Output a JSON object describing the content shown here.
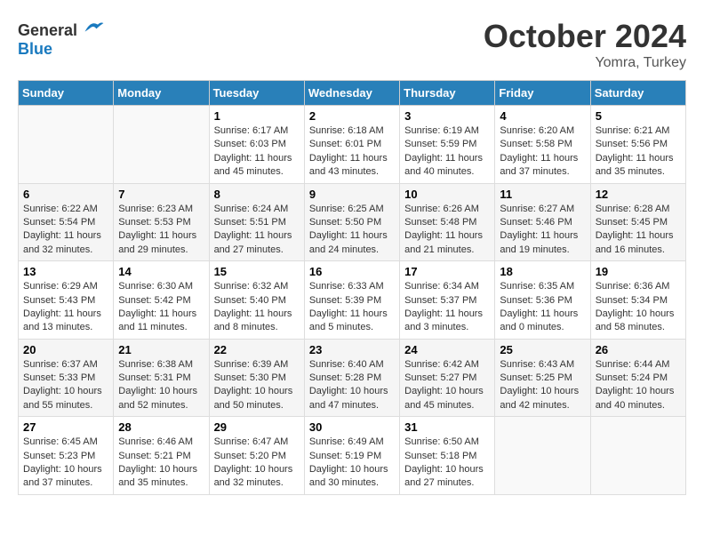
{
  "header": {
    "logo_general": "General",
    "logo_blue": "Blue",
    "month": "October 2024",
    "location": "Yomra, Turkey"
  },
  "weekdays": [
    "Sunday",
    "Monday",
    "Tuesday",
    "Wednesday",
    "Thursday",
    "Friday",
    "Saturday"
  ],
  "weeks": [
    [
      {
        "day": "",
        "info": ""
      },
      {
        "day": "",
        "info": ""
      },
      {
        "day": "1",
        "info": "Sunrise: 6:17 AM\nSunset: 6:03 PM\nDaylight: 11 hours and 45 minutes."
      },
      {
        "day": "2",
        "info": "Sunrise: 6:18 AM\nSunset: 6:01 PM\nDaylight: 11 hours and 43 minutes."
      },
      {
        "day": "3",
        "info": "Sunrise: 6:19 AM\nSunset: 5:59 PM\nDaylight: 11 hours and 40 minutes."
      },
      {
        "day": "4",
        "info": "Sunrise: 6:20 AM\nSunset: 5:58 PM\nDaylight: 11 hours and 37 minutes."
      },
      {
        "day": "5",
        "info": "Sunrise: 6:21 AM\nSunset: 5:56 PM\nDaylight: 11 hours and 35 minutes."
      }
    ],
    [
      {
        "day": "6",
        "info": "Sunrise: 6:22 AM\nSunset: 5:54 PM\nDaylight: 11 hours and 32 minutes."
      },
      {
        "day": "7",
        "info": "Sunrise: 6:23 AM\nSunset: 5:53 PM\nDaylight: 11 hours and 29 minutes."
      },
      {
        "day": "8",
        "info": "Sunrise: 6:24 AM\nSunset: 5:51 PM\nDaylight: 11 hours and 27 minutes."
      },
      {
        "day": "9",
        "info": "Sunrise: 6:25 AM\nSunset: 5:50 PM\nDaylight: 11 hours and 24 minutes."
      },
      {
        "day": "10",
        "info": "Sunrise: 6:26 AM\nSunset: 5:48 PM\nDaylight: 11 hours and 21 minutes."
      },
      {
        "day": "11",
        "info": "Sunrise: 6:27 AM\nSunset: 5:46 PM\nDaylight: 11 hours and 19 minutes."
      },
      {
        "day": "12",
        "info": "Sunrise: 6:28 AM\nSunset: 5:45 PM\nDaylight: 11 hours and 16 minutes."
      }
    ],
    [
      {
        "day": "13",
        "info": "Sunrise: 6:29 AM\nSunset: 5:43 PM\nDaylight: 11 hours and 13 minutes."
      },
      {
        "day": "14",
        "info": "Sunrise: 6:30 AM\nSunset: 5:42 PM\nDaylight: 11 hours and 11 minutes."
      },
      {
        "day": "15",
        "info": "Sunrise: 6:32 AM\nSunset: 5:40 PM\nDaylight: 11 hours and 8 minutes."
      },
      {
        "day": "16",
        "info": "Sunrise: 6:33 AM\nSunset: 5:39 PM\nDaylight: 11 hours and 5 minutes."
      },
      {
        "day": "17",
        "info": "Sunrise: 6:34 AM\nSunset: 5:37 PM\nDaylight: 11 hours and 3 minutes."
      },
      {
        "day": "18",
        "info": "Sunrise: 6:35 AM\nSunset: 5:36 PM\nDaylight: 11 hours and 0 minutes."
      },
      {
        "day": "19",
        "info": "Sunrise: 6:36 AM\nSunset: 5:34 PM\nDaylight: 10 hours and 58 minutes."
      }
    ],
    [
      {
        "day": "20",
        "info": "Sunrise: 6:37 AM\nSunset: 5:33 PM\nDaylight: 10 hours and 55 minutes."
      },
      {
        "day": "21",
        "info": "Sunrise: 6:38 AM\nSunset: 5:31 PM\nDaylight: 10 hours and 52 minutes."
      },
      {
        "day": "22",
        "info": "Sunrise: 6:39 AM\nSunset: 5:30 PM\nDaylight: 10 hours and 50 minutes."
      },
      {
        "day": "23",
        "info": "Sunrise: 6:40 AM\nSunset: 5:28 PM\nDaylight: 10 hours and 47 minutes."
      },
      {
        "day": "24",
        "info": "Sunrise: 6:42 AM\nSunset: 5:27 PM\nDaylight: 10 hours and 45 minutes."
      },
      {
        "day": "25",
        "info": "Sunrise: 6:43 AM\nSunset: 5:25 PM\nDaylight: 10 hours and 42 minutes."
      },
      {
        "day": "26",
        "info": "Sunrise: 6:44 AM\nSunset: 5:24 PM\nDaylight: 10 hours and 40 minutes."
      }
    ],
    [
      {
        "day": "27",
        "info": "Sunrise: 6:45 AM\nSunset: 5:23 PM\nDaylight: 10 hours and 37 minutes."
      },
      {
        "day": "28",
        "info": "Sunrise: 6:46 AM\nSunset: 5:21 PM\nDaylight: 10 hours and 35 minutes."
      },
      {
        "day": "29",
        "info": "Sunrise: 6:47 AM\nSunset: 5:20 PM\nDaylight: 10 hours and 32 minutes."
      },
      {
        "day": "30",
        "info": "Sunrise: 6:49 AM\nSunset: 5:19 PM\nDaylight: 10 hours and 30 minutes."
      },
      {
        "day": "31",
        "info": "Sunrise: 6:50 AM\nSunset: 5:18 PM\nDaylight: 10 hours and 27 minutes."
      },
      {
        "day": "",
        "info": ""
      },
      {
        "day": "",
        "info": ""
      }
    ]
  ]
}
